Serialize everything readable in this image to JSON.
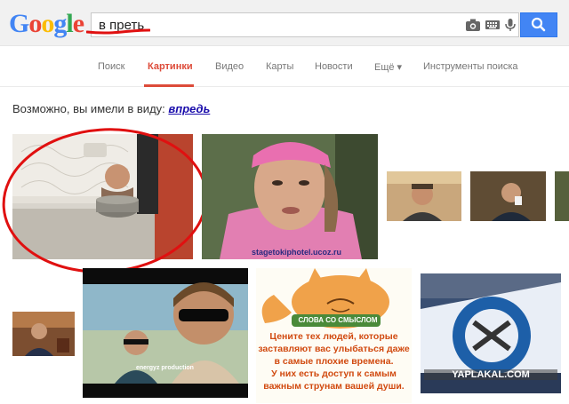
{
  "logo": {
    "letters": [
      "G",
      "o",
      "o",
      "g",
      "l",
      "e"
    ],
    "colors": [
      "#4285f4",
      "#ea4335",
      "#fbbc05",
      "#4285f4",
      "#34a853",
      "#ea4335"
    ]
  },
  "search": {
    "value": "в преть"
  },
  "tabs": [
    {
      "label": "Поиск"
    },
    {
      "label": "Картинки"
    },
    {
      "label": "Видео"
    },
    {
      "label": "Карты"
    },
    {
      "label": "Новости"
    },
    {
      "label": "Ещё ▾"
    },
    {
      "label": "Инструменты поиска"
    }
  ],
  "did_you_mean": {
    "prefix": "Возможно, вы имели в виду:",
    "suggestion": "впредь"
  },
  "images": {
    "stagetoki_caption": "stagetokiphotel.ucoz.ru",
    "energy_caption": "energyz production",
    "cat_title": "СЛОВА СО СМЫСЛОМ",
    "cat_text": [
      "Цените тех людей, которые",
      "заставляют вас улыбаться даже",
      "в самые плохие времена.",
      "У них есть доступ к самым",
      "важным струнам вашей души."
    ],
    "yaplakal": "YAPLAKAL.COM"
  },
  "colors": {
    "accent": "#dd4b39",
    "link": "#1a0dab",
    "search_button": "#4285f4"
  }
}
